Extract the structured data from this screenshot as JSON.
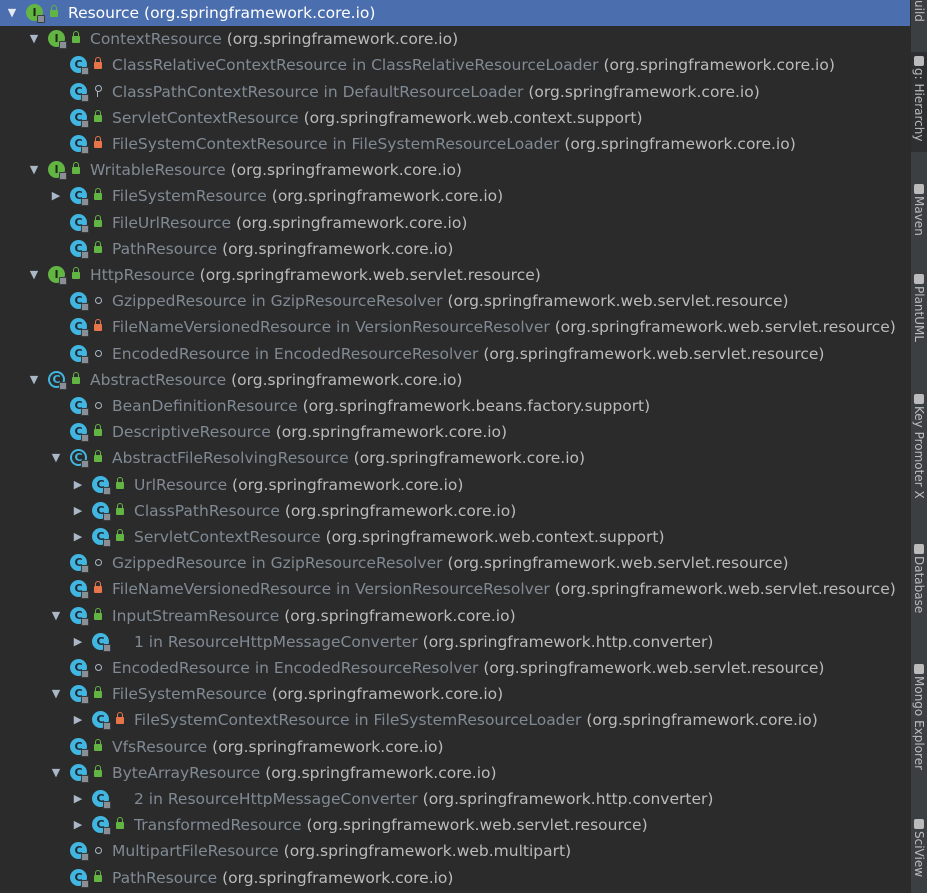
{
  "tree": {
    "rows": [
      {
        "depth": 0,
        "expand": "down",
        "icon": "interface",
        "vis": "public",
        "name": "Resource",
        "outer": "",
        "pkg": "(org.springframework.core.io)",
        "selected": true
      },
      {
        "depth": 1,
        "expand": "down",
        "icon": "interface",
        "vis": "public",
        "name": "ContextResource",
        "outer": "",
        "pkg": "(org.springframework.core.io)"
      },
      {
        "depth": 2,
        "expand": "",
        "icon": "class",
        "vis": "private",
        "name": "ClassRelativeContextResource in ClassRelativeResourceLoader",
        "outer": "",
        "pkg": "(org.springframework.core.io)"
      },
      {
        "depth": 2,
        "expand": "",
        "icon": "class",
        "vis": "key",
        "name": "ClassPathContextResource in DefaultResourceLoader",
        "outer": "",
        "pkg": "(org.springframework.core.io)"
      },
      {
        "depth": 2,
        "expand": "",
        "icon": "class",
        "vis": "public",
        "name": "ServletContextResource",
        "outer": "",
        "pkg": "(org.springframework.web.context.support)"
      },
      {
        "depth": 2,
        "expand": "",
        "icon": "class",
        "vis": "private",
        "name": "FileSystemContextResource in FileSystemResourceLoader",
        "outer": "",
        "pkg": "(org.springframework.core.io)"
      },
      {
        "depth": 1,
        "expand": "down",
        "icon": "interface",
        "vis": "public",
        "name": "WritableResource",
        "outer": "",
        "pkg": "(org.springframework.core.io)"
      },
      {
        "depth": 2,
        "expand": "right",
        "icon": "class",
        "vis": "public",
        "name": "FileSystemResource",
        "outer": "",
        "pkg": "(org.springframework.core.io)"
      },
      {
        "depth": 2,
        "expand": "",
        "icon": "class",
        "vis": "public",
        "name": "FileUrlResource",
        "outer": "",
        "pkg": "(org.springframework.core.io)"
      },
      {
        "depth": 2,
        "expand": "",
        "icon": "class",
        "vis": "public",
        "name": "PathResource",
        "outer": "",
        "pkg": "(org.springframework.core.io)"
      },
      {
        "depth": 1,
        "expand": "down",
        "icon": "interface",
        "vis": "public",
        "name": "HttpResource",
        "outer": "",
        "pkg": "(org.springframework.web.servlet.resource)"
      },
      {
        "depth": 2,
        "expand": "",
        "icon": "class",
        "vis": "package",
        "name": "GzippedResource in GzipResourceResolver",
        "outer": "",
        "pkg": "(org.springframework.web.servlet.resource)"
      },
      {
        "depth": 2,
        "expand": "",
        "icon": "class",
        "vis": "private",
        "name": "FileNameVersionedResource in VersionResourceResolver",
        "outer": "",
        "pkg": "(org.springframework.web.servlet.resource)"
      },
      {
        "depth": 2,
        "expand": "",
        "icon": "class",
        "vis": "package",
        "name": "EncodedResource in EncodedResourceResolver",
        "outer": "",
        "pkg": "(org.springframework.web.servlet.resource)"
      },
      {
        "depth": 1,
        "expand": "down",
        "icon": "abstract",
        "vis": "public",
        "name": "AbstractResource",
        "outer": "",
        "pkg": "(org.springframework.core.io)"
      },
      {
        "depth": 2,
        "expand": "",
        "icon": "class",
        "vis": "package",
        "name": "BeanDefinitionResource",
        "outer": "",
        "pkg": "(org.springframework.beans.factory.support)"
      },
      {
        "depth": 2,
        "expand": "",
        "icon": "class",
        "vis": "public",
        "name": "DescriptiveResource",
        "outer": "",
        "pkg": "(org.springframework.core.io)"
      },
      {
        "depth": 2,
        "expand": "down",
        "icon": "abstract",
        "vis": "public",
        "name": "AbstractFileResolvingResource",
        "outer": "",
        "pkg": "(org.springframework.core.io)"
      },
      {
        "depth": 3,
        "expand": "right",
        "icon": "class",
        "vis": "public",
        "name": "UrlResource",
        "outer": "",
        "pkg": "(org.springframework.core.io)"
      },
      {
        "depth": 3,
        "expand": "right",
        "icon": "class",
        "vis": "public",
        "name": "ClassPathResource",
        "outer": "",
        "pkg": "(org.springframework.core.io)"
      },
      {
        "depth": 3,
        "expand": "right",
        "icon": "class",
        "vis": "public",
        "name": "ServletContextResource",
        "outer": "",
        "pkg": "(org.springframework.web.context.support)"
      },
      {
        "depth": 2,
        "expand": "",
        "icon": "class",
        "vis": "package",
        "name": "GzippedResource in GzipResourceResolver",
        "outer": "",
        "pkg": "(org.springframework.web.servlet.resource)"
      },
      {
        "depth": 2,
        "expand": "",
        "icon": "class",
        "vis": "private",
        "name": "FileNameVersionedResource in VersionResourceResolver",
        "outer": "",
        "pkg": "(org.springframework.web.servlet.resource)"
      },
      {
        "depth": 2,
        "expand": "down",
        "icon": "class",
        "vis": "public",
        "name": "InputStreamResource",
        "outer": "",
        "pkg": "(org.springframework.core.io)"
      },
      {
        "depth": 3,
        "expand": "right",
        "icon": "class",
        "vis": "",
        "name": "1 in ResourceHttpMessageConverter",
        "outer": "",
        "pkg": "(org.springframework.http.converter)"
      },
      {
        "depth": 2,
        "expand": "",
        "icon": "class",
        "vis": "package",
        "name": "EncodedResource in EncodedResourceResolver",
        "outer": "",
        "pkg": "(org.springframework.web.servlet.resource)"
      },
      {
        "depth": 2,
        "expand": "down",
        "icon": "class",
        "vis": "public",
        "name": "FileSystemResource",
        "outer": "",
        "pkg": "(org.springframework.core.io)"
      },
      {
        "depth": 3,
        "expand": "right",
        "icon": "class",
        "vis": "private",
        "name": "FileSystemContextResource in FileSystemResourceLoader",
        "outer": "",
        "pkg": "(org.springframework.core.io)"
      },
      {
        "depth": 2,
        "expand": "",
        "icon": "class",
        "vis": "public",
        "name": "VfsResource",
        "outer": "",
        "pkg": "(org.springframework.core.io)"
      },
      {
        "depth": 2,
        "expand": "down",
        "icon": "class",
        "vis": "public",
        "name": "ByteArrayResource",
        "outer": "",
        "pkg": "(org.springframework.core.io)"
      },
      {
        "depth": 3,
        "expand": "right",
        "icon": "class",
        "vis": "",
        "name": "2 in ResourceHttpMessageConverter",
        "outer": "",
        "pkg": "(org.springframework.http.converter)"
      },
      {
        "depth": 3,
        "expand": "right",
        "icon": "class",
        "vis": "public",
        "name": "TransformedResource",
        "outer": "",
        "pkg": "(org.springframework.web.servlet.resource)"
      },
      {
        "depth": 2,
        "expand": "",
        "icon": "class",
        "vis": "package",
        "name": "MultipartFileResource",
        "outer": "",
        "pkg": "(org.springframework.web.multipart)"
      },
      {
        "depth": 2,
        "expand": "",
        "icon": "class",
        "vis": "public",
        "name": "PathResource",
        "outer": "",
        "pkg": "(org.springframework.core.io)"
      }
    ]
  },
  "sidebar": {
    "tabs": [
      {
        "label": "uild",
        "icon": "",
        "active": false
      },
      {
        "label": "g: Hierarchy",
        "icon": "hierarchy-icon",
        "active": true
      },
      {
        "label": "Maven",
        "icon": "maven-icon",
        "active": false
      },
      {
        "label": "PlantUML",
        "icon": "plantuml-icon",
        "active": false
      },
      {
        "label": "Key Promoter X",
        "icon": "key-promoter-icon",
        "active": false
      },
      {
        "label": "Database",
        "icon": "database-icon",
        "active": false
      },
      {
        "label": "Mongo Explorer",
        "icon": "mongo-icon",
        "active": false
      },
      {
        "label": "SciView",
        "icon": "sciview-icon",
        "active": false
      }
    ]
  },
  "colors": {
    "background": "#2b2b2b",
    "selection": "#4b6eaf",
    "interface_icon": "#62b543",
    "class_icon": "#40b6e0",
    "public_lock": "#62b543",
    "private_lock": "#e8754a",
    "class_name": "#808a94",
    "package_name": "#bbbbbb"
  }
}
